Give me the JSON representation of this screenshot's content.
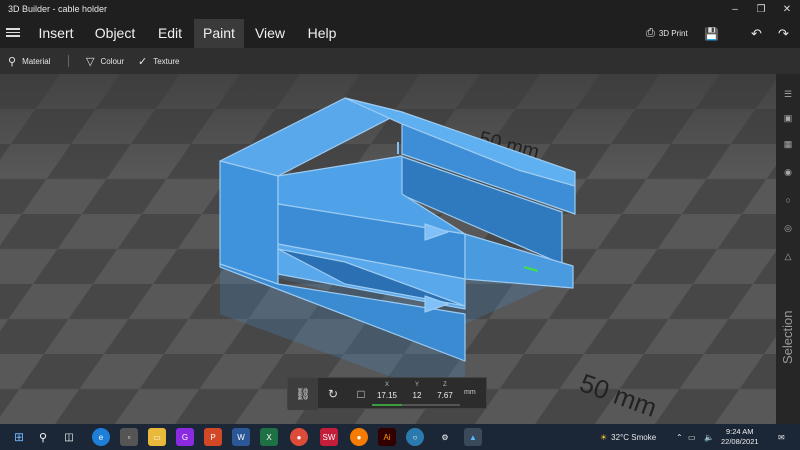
{
  "window": {
    "title": "3D Builder - cable holder",
    "controls": [
      "minimize",
      "restore",
      "close"
    ]
  },
  "menu": {
    "items": [
      "Insert",
      "Object",
      "Edit",
      "Paint",
      "View",
      "Help"
    ],
    "active": "Paint"
  },
  "toolbar_right": {
    "print_label": "3D Print"
  },
  "subtoolbar": {
    "material_label": "Material",
    "colour_label": "Colour",
    "texture_label": "Texture"
  },
  "viewport": {
    "grid_label_top": "50 mm",
    "grid_label_bottom": "50 mm",
    "model_color": "#4a9ae0"
  },
  "right_panel": {
    "label": "Selection"
  },
  "transform": {
    "x_label": "X",
    "y_label": "Y",
    "z_label": "Z",
    "x_value": "17.15",
    "y_value": "12",
    "z_value": "7.67",
    "unit": "mm"
  },
  "taskbar": {
    "weather": "32°C  Smoke",
    "time": "9:24 AM",
    "date": "22/08/2021"
  }
}
